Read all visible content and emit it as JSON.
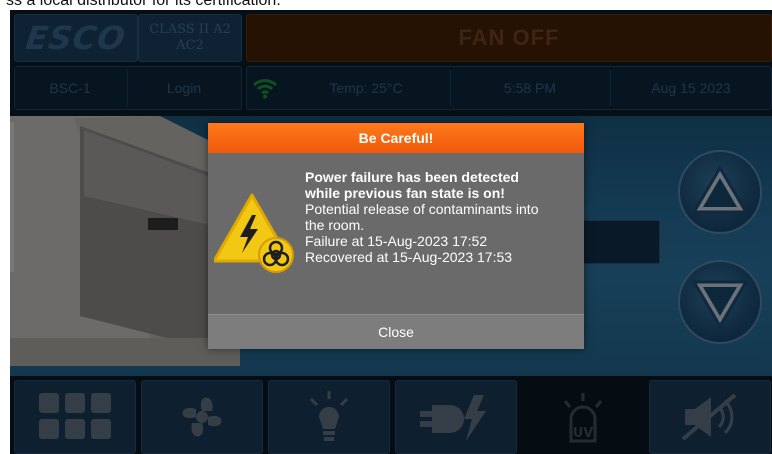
{
  "caption": "ss a local distributor for its certification.",
  "header": {
    "logo_text": "ESCO",
    "class_line1": "CLASS II A2",
    "class_line2": "AC2",
    "fan_status": "FAN OFF"
  },
  "status_bar": {
    "unit_name": "BSC-1",
    "login_label": "Login",
    "wifi_icon": "wifi-icon",
    "temperature": "Temp: 25°C",
    "time": "5:58 PM",
    "date": "Aug 15 2023"
  },
  "controls": {
    "up_icon": "arrow-up-icon",
    "down_icon": "arrow-down-icon"
  },
  "toolbar": {
    "items": [
      {
        "icon": "menu-grid-icon"
      },
      {
        "icon": "fan-icon"
      },
      {
        "icon": "light-bulb-icon"
      },
      {
        "icon": "power-socket-icon"
      },
      {
        "icon": "uv-lamp-icon"
      },
      {
        "icon": "mute-alarm-icon"
      }
    ]
  },
  "dialog": {
    "title": "Be Careful!",
    "icon": "electrical-biohazard-warning-icon",
    "message_bold_1": "Power failure has been detected",
    "message_bold_2": "while previous fan state is on!",
    "message_1": "Potential release of contaminants into",
    "message_2": "the room.",
    "failure_text": "Failure at 15-Aug-2023 17:52",
    "recovered_text": "Recovered at 15-Aug-2023 17:53",
    "close_label": "Close"
  },
  "colors": {
    "dialog_title": "#f26a12",
    "dialog_body": "#6a6a6a",
    "screen_background": "#0c1d2c",
    "fan_bar": "#4a2507"
  }
}
